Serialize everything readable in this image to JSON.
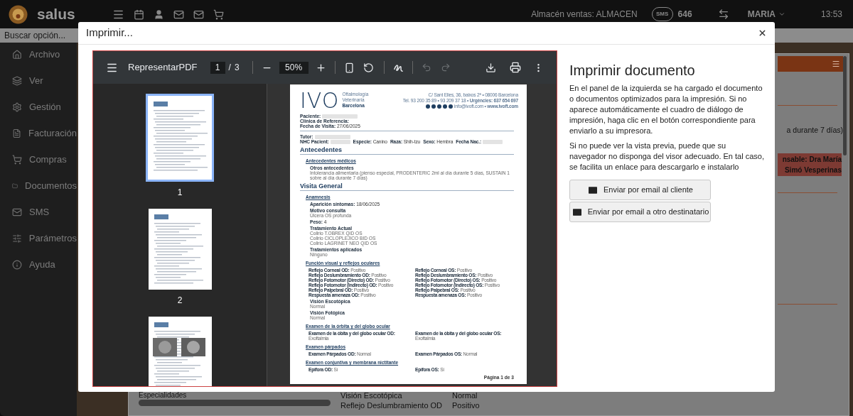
{
  "topbar": {
    "app_name": "salus",
    "store": "Almacén ventas: ALMACEN",
    "sms_badge": "SMS",
    "sms_count": "646",
    "user": "MARIA",
    "time": "13:53"
  },
  "search": {
    "placeholder": "Buscar opción..."
  },
  "sidebar": {
    "items": [
      {
        "label": "Archivo"
      },
      {
        "label": "Ver"
      },
      {
        "label": "Gestión"
      },
      {
        "label": "Facturación"
      },
      {
        "label": "Compras"
      },
      {
        "label": "Documentos"
      },
      {
        "label": "SMS"
      },
      {
        "label": "Parámetros"
      },
      {
        "label": "Ayuda"
      }
    ]
  },
  "background": {
    "note": "a durante 7 días)",
    "highlight": [
      "nsable: Dra María",
      "Simó Vesperinas"
    ],
    "bottom_label": "Especialidades",
    "rows": [
      {
        "label": "Visión Escotópica",
        "value": "Normal"
      },
      {
        "label": "Reflejo Deslumbramiento OD",
        "value": "Positivo"
      }
    ]
  },
  "dialog": {
    "title": "Imprimir...",
    "viewer": {
      "file_name": "RepresentarPDF",
      "page": "1",
      "separator": "/",
      "page_count": "3",
      "zoom": "50%",
      "undo": {
        "disabled": true
      },
      "redo": {
        "disabled": true
      },
      "thumbnails": [
        {
          "label": "1",
          "selected": true
        },
        {
          "label": "2",
          "selected": false
        },
        {
          "selected": false
        }
      ],
      "document": {
        "logo": "IVO",
        "logo_lines": [
          "Oftalmología",
          "Veterinaria",
          "Barcelona"
        ],
        "address": [
          "C/ Sant Elies, 36, baixos 2ª • 08006 Barcelona",
          "Tel. 93 200 35 89 • 93 209 37 18 • **Urgències: 637 654 697**",
          "info@ivoft.com • **www.ivoft.com**"
        ],
        "blocks": [
          {
            "kind": "fields",
            "items": [
              {
                "label": "Paciente:",
                "redacted": true
              },
              {
                "label": "Clínica de Referencia:",
                "redacted": false
              },
              {
                "label": "Fecha de Visita:",
                "value": "27/06/2025",
                "redacted": false
              }
            ]
          },
          {
            "kind": "rule"
          },
          {
            "kind": "fields",
            "items": [
              {
                "label": "Tutor:",
                "redacted": true
              }
            ]
          },
          {
            "kind": "inline",
            "items": [
              {
                "label": "NHC Pacient:",
                "redacted": true
              },
              {
                "label": "Especie:",
                "value": "Canino",
                "redacted": false
              },
              {
                "label": "Raza:",
                "value": "Shih-tzu",
                "redacted": false
              },
              {
                "label": "Sexo:",
                "value": "Hembra",
                "redacted": false
              },
              {
                "label": "Fecha Nac.:",
                "redacted": true
              }
            ]
          },
          {
            "kind": "heading",
            "text": "Antecedentes"
          },
          {
            "kind": "subheading",
            "text": "Antecedentes médicos"
          },
          {
            "kind": "entry",
            "label": "Otros antecedentes",
            "lines": [
              "Intolerancia alimentaria (pienso especial, PRODENTERIC 2ml al día durante 5 días, SUSTAIN 1 sobre al día durante 7 días)"
            ]
          },
          {
            "kind": "heading",
            "text": "Visita General"
          },
          {
            "kind": "subheading",
            "text": "Anamnesis"
          },
          {
            "kind": "field",
            "label": "Aparición síntomas:",
            "value": "18/06/2025"
          },
          {
            "kind": "entry",
            "label": "Motivo consulta",
            "lines": [
              "Úlcera OS profunda"
            ]
          },
          {
            "kind": "field",
            "label": "Peso:",
            "value": "4"
          },
          {
            "kind": "entry",
            "label": "Tratamiento Actual",
            "lines": [
              "Colirio T.OBREX QID OS",
              "Colirio CICLOPLEJICO BID OS",
              "Colirio LAGRINET NEO QID OS"
            ]
          },
          {
            "kind": "entry",
            "label": "Tratamientos aplicados",
            "lines": [
              "Ninguno"
            ]
          },
          {
            "kind": "subheading",
            "text": "Función visual y reflejos oculares"
          },
          {
            "kind": "pairs",
            "rows": [
              [
                {
                  "label": "Reflejo Corneal OD:",
                  "value": "Positivo"
                },
                {
                  "label": "Reflejo Corneal OS:",
                  "value": "Positivo"
                }
              ],
              [
                {
                  "label": "Reflejo Deslumbramiento OD:",
                  "value": "Positivo"
                },
                {
                  "label": "Reflejo Deslumbramiento OS:",
                  "value": "Positivo"
                }
              ],
              [
                {
                  "label": "Reflejo Fotomotor (Directo) OD:",
                  "value": "Positivo"
                },
                {
                  "label": "Reflejo Fotomotor (Directo) OS:",
                  "value": "Positivo"
                }
              ],
              [
                {
                  "label": "Reflejo Fotomotor (Indirecto) OD:",
                  "value": "Positivo"
                },
                {
                  "label": "Reflejo Fotomotor (Indirecto) OS:",
                  "value": "Positivo"
                }
              ],
              [
                {
                  "label": "Reflejo Palpebral OD:",
                  "value": "Positivo"
                },
                {
                  "label": "Reflejo Palpebral OS:",
                  "value": "Positivo"
                }
              ],
              [
                {
                  "label": "Respuesta amenaza OD:",
                  "value": "Positivo"
                },
                {
                  "label": "Respuesta amenaza OS:",
                  "value": "Positivo"
                }
              ]
            ]
          },
          {
            "kind": "entry",
            "label": "Visión Escotópica",
            "lines": [
              "Normal"
            ]
          },
          {
            "kind": "entry",
            "label": "Visión Fotópica",
            "lines": [
              "Normal"
            ]
          },
          {
            "kind": "subheading",
            "text": "Examen de la órbita y del globo ocular"
          },
          {
            "kind": "pairs",
            "rows": [
              [
                {
                  "label": "Examen de la óbita y del globo ocular OD:",
                  "value": "Exoftalmia"
                },
                {
                  "label": "Examen de la óbita y del globo ocular OS:",
                  "value": "Exoftalmia"
                }
              ]
            ]
          },
          {
            "kind": "subheading",
            "text": "Examen párpados"
          },
          {
            "kind": "pairs",
            "rows": [
              [
                {
                  "label": "Examen Párpados OD:",
                  "value": "Normal"
                },
                {
                  "label": "Examen Párpados OS:",
                  "value": "Normal"
                }
              ]
            ]
          },
          {
            "kind": "subheading",
            "text": "Examen conjuntiva y membrana nictitante"
          },
          {
            "kind": "pairs",
            "rows": [
              [
                {
                  "label": "Epífora OD:",
                  "value": "Sí"
                },
                {
                  "label": "Epífora OS:",
                  "value": "Sí"
                }
              ]
            ]
          },
          {
            "kind": "footer",
            "text": "Página 1 de 3"
          }
        ]
      }
    },
    "panel": {
      "heading": "Imprimir documento",
      "paragraphs": [
        "En el panel de la izquierda se ha cargado el documento o documentos optimizados para la impresión. Si no aparece automáticamente el cuadro de diálogo de impresión, haga clic en el botón correspondiente para enviarlo a su impresora.",
        "Si no puede ver la vista previa, puede que su navegador no disponga del visor adecuado. En tal caso, se facilita un enlace para descargarlo e instalarlo"
      ],
      "buttons": [
        {
          "label": "Enviar por email al cliente"
        },
        {
          "label": "Enviar por email a otro destinatario"
        }
      ]
    }
  }
}
